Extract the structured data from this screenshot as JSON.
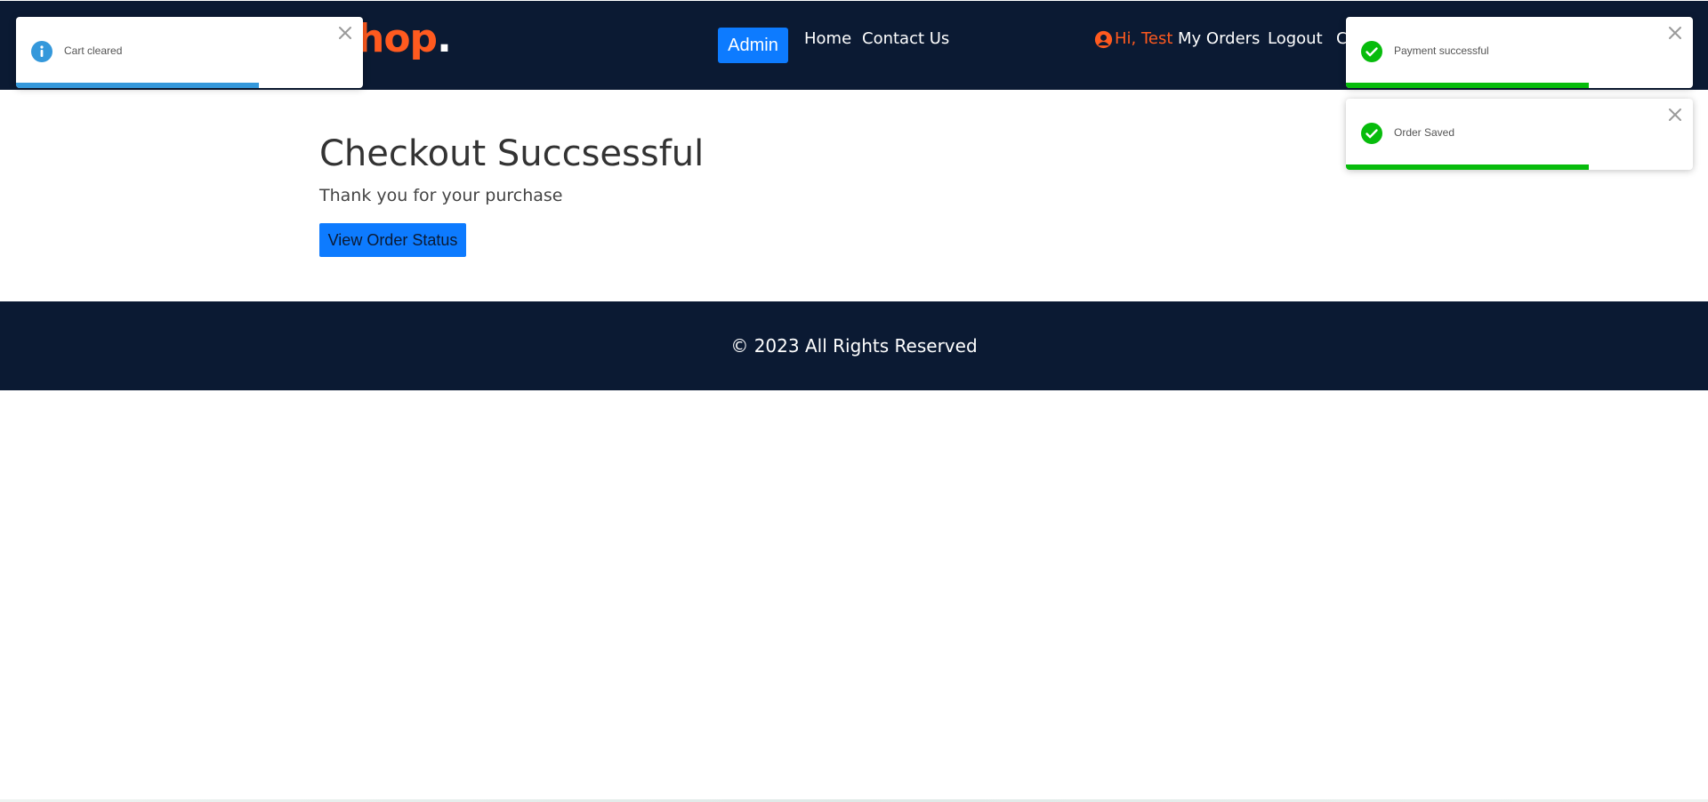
{
  "header": {
    "logo_text": "hop",
    "logo_dot": ".",
    "admin_label": "Admin",
    "nav": {
      "home": "Home",
      "contact": "Contact Us"
    },
    "user_greeting": "Hi, Test",
    "my_orders": "My Orders",
    "logout": "Logout",
    "cart_partial": "C",
    "user_icon": "user-circle-icon"
  },
  "main": {
    "title": "Checkout Succsessful",
    "subtitle": "Thank you for your purchase",
    "view_order_status": "View Order Status"
  },
  "footer": {
    "copyright": "© 2023 All Rights Reserved"
  },
  "toasts": [
    {
      "message": "Cart cleared",
      "type": "info",
      "color": "#3498db",
      "icon": "info-icon",
      "progress": 0.7
    },
    {
      "message": "Payment successful",
      "type": "success",
      "color": "#07bc0c",
      "icon": "check-circle-icon",
      "progress": 0.7
    },
    {
      "message": "Order Saved",
      "type": "success",
      "color": "#07bc0c",
      "icon": "check-circle-icon",
      "progress": 0.7
    }
  ],
  "colors": {
    "navbar_bg": "#0b1a33",
    "accent_orange": "#ff5a1f",
    "primary_blue": "#0d7bff"
  }
}
